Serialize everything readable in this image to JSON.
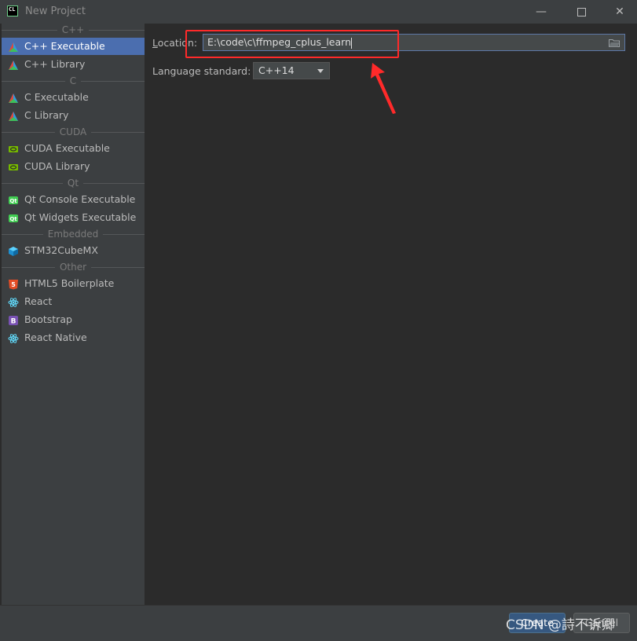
{
  "window": {
    "title": "New Project",
    "app_icon_text": "CL",
    "minimize": "—",
    "close": "✕"
  },
  "sidebar": {
    "groups": [
      {
        "header": "C++",
        "items": [
          {
            "label": "C++ Executable",
            "icon": "cmake-triangle-icon",
            "selected": true
          },
          {
            "label": "C++ Library",
            "icon": "cmake-triangle-icon"
          }
        ]
      },
      {
        "header": "C",
        "items": [
          {
            "label": "C Executable",
            "icon": "cmake-triangle-icon"
          },
          {
            "label": "C Library",
            "icon": "cmake-triangle-icon"
          }
        ]
      },
      {
        "header": "CUDA",
        "items": [
          {
            "label": "CUDA Executable",
            "icon": "nvidia-icon"
          },
          {
            "label": "CUDA Library",
            "icon": "nvidia-icon"
          }
        ]
      },
      {
        "header": "Qt",
        "items": [
          {
            "label": "Qt Console Executable",
            "icon": "qt-icon"
          },
          {
            "label": "Qt Widgets Executable",
            "icon": "qt-icon"
          }
        ]
      },
      {
        "header": "Embedded",
        "items": [
          {
            "label": "STM32CubeMX",
            "icon": "cube-icon"
          }
        ]
      },
      {
        "header": "Other",
        "items": [
          {
            "label": "HTML5 Boilerplate",
            "icon": "html5-icon"
          },
          {
            "label": "React",
            "icon": "react-icon"
          },
          {
            "label": "Bootstrap",
            "icon": "bootstrap-icon"
          },
          {
            "label": "React Native",
            "icon": "react-icon"
          }
        ]
      }
    ]
  },
  "form": {
    "location_label_underlined": "L",
    "location_label_rest": "ocation:",
    "location_value": "E:\\code\\c\\ffmpeg_cplus_learn",
    "language_label": "Language standard:",
    "language_value": "C++14"
  },
  "buttons": {
    "create": "Create",
    "cancel": "Cancel"
  },
  "watermark": "CSDN @詩不诉卿",
  "colors": {
    "selection": "#4b6eaf",
    "highlight": "#ff2a2a",
    "primary_button": "#365880"
  }
}
